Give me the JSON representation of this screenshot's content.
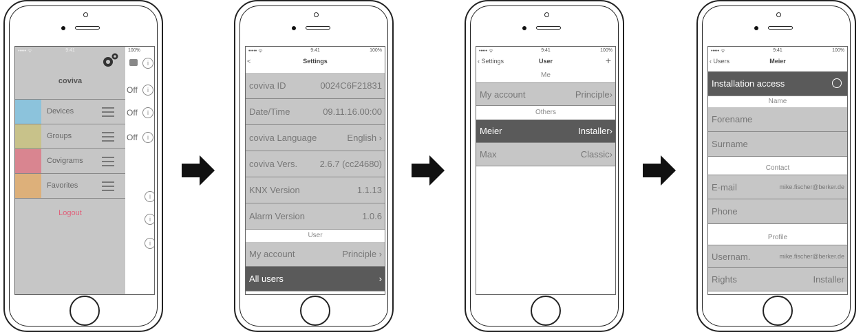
{
  "colors": {
    "cell": "#c6c6c6",
    "dark": "#5a5a5a",
    "devices": "#8cc3dc",
    "groups": "#c8c28a",
    "covigrams": "#d98590",
    "favorites": "#ddb07a",
    "logout": "#e0607a"
  },
  "screen1": {
    "status": {
      "signal": "••••• ᯤ",
      "time": "9:41",
      "battery": "100%"
    },
    "app_name": "coviva",
    "menu": [
      {
        "label": "Devices"
      },
      {
        "label": "Groups"
      },
      {
        "label": "Covigrams"
      },
      {
        "label": "Favorites"
      }
    ],
    "logout": "Logout",
    "toggles": [
      "Off",
      "Off",
      "Off"
    ]
  },
  "screen2": {
    "status": {
      "signal": "••••• ᯤ",
      "time": "9:41",
      "battery": "100%"
    },
    "title": "Settings",
    "back": "<",
    "rows": [
      {
        "label": "coviva ID",
        "value": "0024C6F21831"
      },
      {
        "label": "Date/Time",
        "value": "09.11.16.00:00"
      },
      {
        "label": "coviva Language",
        "value": "English ›"
      },
      {
        "label": "coviva Vers.",
        "value": "2.6.7 (cc24680)"
      },
      {
        "label": "KNX Version",
        "value": "1.1.13"
      },
      {
        "label": "Alarm Version",
        "value": "1.0.6"
      }
    ],
    "section_user": "User",
    "my_account": {
      "label": "My account",
      "value": "Principle ›"
    },
    "all_users": {
      "label": "All users",
      "value": "›"
    }
  },
  "screen3": {
    "status": {
      "signal": "••••• ᯤ",
      "time": "9:41",
      "battery": "100%"
    },
    "back": "‹ Settings",
    "title": "User",
    "plus": "+",
    "section_me": "Me",
    "my_account": {
      "label": "My account",
      "value": "Principle›"
    },
    "section_others": "Others",
    "users": [
      {
        "label": "Meier",
        "value": "Installer›"
      },
      {
        "label": "Max",
        "value": "Classic›"
      }
    ]
  },
  "screen4": {
    "status": {
      "signal": "••••• ᯤ",
      "time": "9:41",
      "battery": "100%"
    },
    "back": "‹ Users",
    "title": "Meier",
    "installation_access": "Installation access",
    "section_name": "Name",
    "forename": "Forename",
    "surname": "Surname",
    "section_contact": "Contact",
    "email": {
      "label": "E-mail",
      "value": "mike.fischer@berker.de"
    },
    "phone": "Phone",
    "section_profile": "Profile",
    "username": {
      "label": "Usernam.",
      "value": "mike.fischer@berker.de"
    },
    "rights": {
      "label": "Rights",
      "value": "Installer"
    }
  }
}
